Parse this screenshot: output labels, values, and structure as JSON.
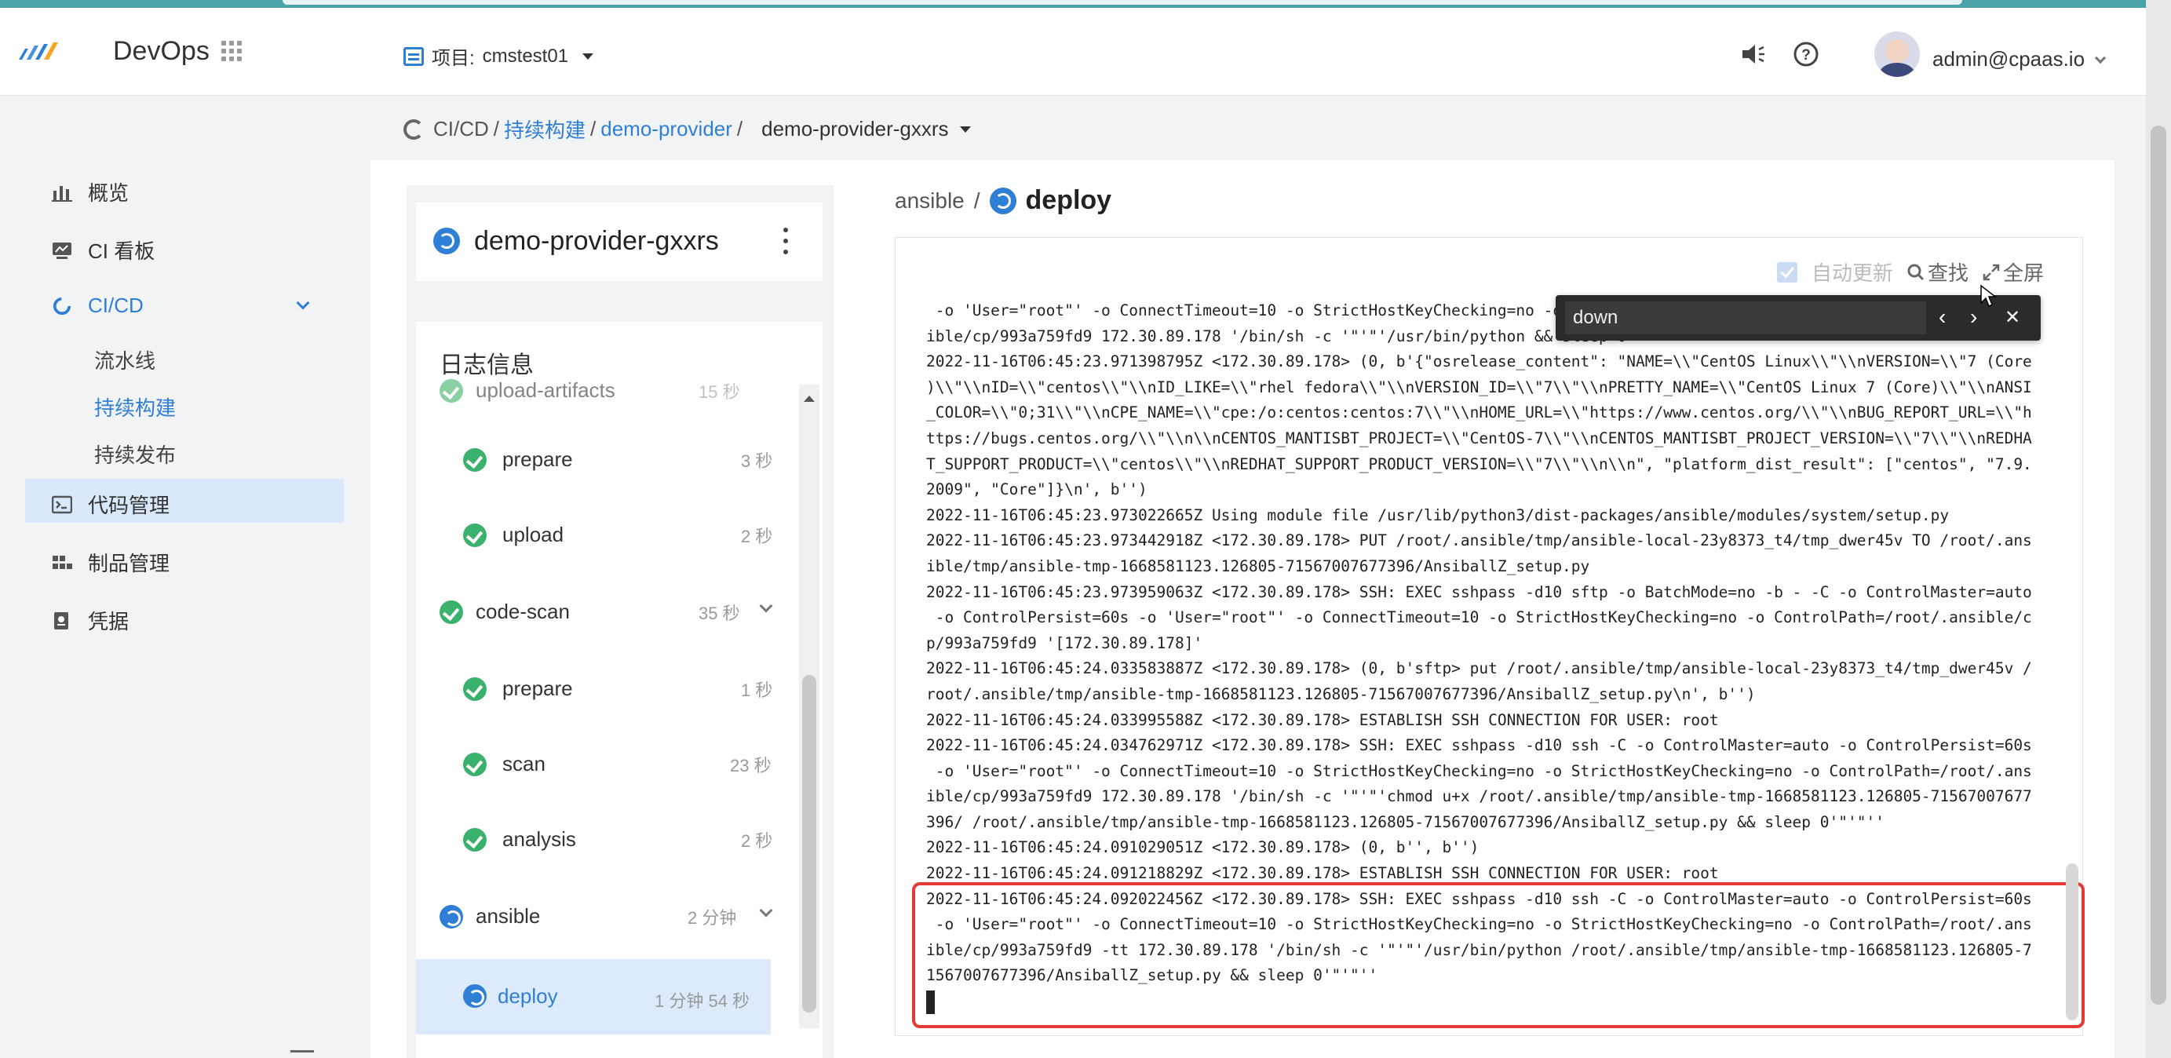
{
  "header": {
    "brand": "DevOps",
    "project_label": "项目:",
    "project_value": "cmstest01",
    "user": "admin@cpaas.io"
  },
  "breadcrumb": {
    "root": "CI/CD",
    "sep1": "/",
    "section": "持续构建",
    "sep2": "/",
    "pipeline": "demo-provider",
    "sep3": "/",
    "current": "demo-provider-gxxrs"
  },
  "sidebar": {
    "items": [
      {
        "label": "概览",
        "icon": "chart-icon"
      },
      {
        "label": "CI 看板",
        "icon": "dashboard-icon"
      },
      {
        "label": "CI/CD",
        "icon": "cicd-icon"
      },
      {
        "label": "流水线"
      },
      {
        "label": "持续构建"
      },
      {
        "label": "持续发布"
      },
      {
        "label": "代码管理",
        "icon": "code-icon"
      },
      {
        "label": "制品管理",
        "icon": "artifact-icon"
      },
      {
        "label": "凭据",
        "icon": "credential-icon"
      }
    ]
  },
  "build": {
    "title": "demo-provider-gxxrs",
    "log_header": "日志信息",
    "steps": [
      {
        "name": "upload-artifacts",
        "duration": "15 秒"
      },
      {
        "name": "prepare",
        "duration": "3 秒"
      },
      {
        "name": "upload",
        "duration": "2 秒"
      },
      {
        "name": "code-scan",
        "duration": "35 秒"
      },
      {
        "name": "prepare",
        "duration": "1 秒"
      },
      {
        "name": "scan",
        "duration": "23 秒"
      },
      {
        "name": "analysis",
        "duration": "2 秒"
      },
      {
        "name": "ansible",
        "duration": "2 分钟"
      },
      {
        "name": "deploy",
        "duration": "1 分钟 54 秒"
      }
    ]
  },
  "log_view": {
    "stage": "ansible",
    "sep": "/",
    "step": "deploy",
    "auto_update": "自动更新",
    "find": "查找",
    "fullscreen": "全屏",
    "search_value": "down",
    "lines": [
      " -o 'User=\"root\"' -o ConnectTimeout=10 -o StrictHostKeyChecking=no -o StrictHostKeyChecking=no -o ControlPath=/root/.ans",
      "ible/cp/993a759fd9 172.30.89.178 '/bin/sh -c '\"'\"'/usr/bin/python && sleep 0'\"'\"''",
      "2022-11-16T06:45:23.971398795Z <172.30.89.178> (0, b'{\"osrelease_content\": \"NAME=\\\\\"CentOS Linux\\\\\"\\\\nVERSION=\\\\\"7 (Core",
      ")\\\\\"\\\\nID=\\\\\"centos\\\\\"\\\\nID_LIKE=\\\\\"rhel fedora\\\\\"\\\\nVERSION_ID=\\\\\"7\\\\\"\\\\nPRETTY_NAME=\\\\\"CentOS Linux 7 (Core)\\\\\"\\\\nANSI",
      "_COLOR=\\\\\"0;31\\\\\"\\\\nCPE_NAME=\\\\\"cpe:/o:centos:centos:7\\\\\"\\\\nHOME_URL=\\\\\"https://www.centos.org/\\\\\"\\\\nBUG_REPORT_URL=\\\\\"h",
      "ttps://bugs.centos.org/\\\\\"\\\\n\\\\nCENTOS_MANTISBT_PROJECT=\\\\\"CentOS-7\\\\\"\\\\nCENTOS_MANTISBT_PROJECT_VERSION=\\\\\"7\\\\\"\\\\nREDHA",
      "T_SUPPORT_PRODUCT=\\\\\"centos\\\\\"\\\\nREDHAT_SUPPORT_PRODUCT_VERSION=\\\\\"7\\\\\"\\\\n\\\\n\", \"platform_dist_result\": [\"centos\", \"7.9.",
      "2009\", \"Core\"]}\\n', b'')",
      "2022-11-16T06:45:23.973022665Z Using module file /usr/lib/python3/dist-packages/ansible/modules/system/setup.py",
      "2022-11-16T06:45:23.973442918Z <172.30.89.178> PUT /root/.ansible/tmp/ansible-local-23y8373_t4/tmp_dwer45v TO /root/.ans",
      "ible/tmp/ansible-tmp-1668581123.126805-71567007677396/AnsiballZ_setup.py",
      "2022-11-16T06:45:23.973959063Z <172.30.89.178> SSH: EXEC sshpass -d10 sftp -o BatchMode=no -b - -C -o ControlMaster=auto",
      " -o ControlPersist=60s -o 'User=\"root\"' -o ConnectTimeout=10 -o StrictHostKeyChecking=no -o ControlPath=/root/.ansible/c",
      "p/993a759fd9 '[172.30.89.178]'",
      "2022-11-16T06:45:24.033583887Z <172.30.89.178> (0, b'sftp> put /root/.ansible/tmp/ansible-local-23y8373_t4/tmp_dwer45v /",
      "root/.ansible/tmp/ansible-tmp-1668581123.126805-71567007677396/AnsiballZ_setup.py\\n', b'')",
      "2022-11-16T06:45:24.033995588Z <172.30.89.178> ESTABLISH SSH CONNECTION FOR USER: root",
      "2022-11-16T06:45:24.034762971Z <172.30.89.178> SSH: EXEC sshpass -d10 ssh -C -o ControlMaster=auto -o ControlPersist=60s",
      " -o 'User=\"root\"' -o ConnectTimeout=10 -o StrictHostKeyChecking=no -o StrictHostKeyChecking=no -o ControlPath=/root/.ans",
      "ible/cp/993a759fd9 172.30.89.178 '/bin/sh -c '\"'\"'chmod u+x /root/.ansible/tmp/ansible-tmp-1668581123.126805-71567007677",
      "396/ /root/.ansible/tmp/ansible-tmp-1668581123.126805-71567007677396/AnsiballZ_setup.py && sleep 0'\"'\"''",
      "2022-11-16T06:45:24.091029051Z <172.30.89.178> (0, b'', b'')",
      "2022-11-16T06:45:24.091218829Z <172.30.89.178> ESTABLISH SSH CONNECTION FOR USER: root",
      "2022-11-16T06:45:24.092022456Z <172.30.89.178> SSH: EXEC sshpass -d10 ssh -C -o ControlMaster=auto -o ControlPersist=60s",
      " -o 'User=\"root\"' -o ConnectTimeout=10 -o StrictHostKeyChecking=no -o StrictHostKeyChecking=no -o ControlPath=/root/.ans",
      "ible/cp/993a759fd9 -tt 172.30.89.178 '/bin/sh -c '\"'\"'/usr/bin/python /root/.ansible/tmp/ansible-tmp-1668581123.126805-7",
      "1567007677396/AnsiballZ_setup.py && sleep 0'\"'\"''"
    ]
  },
  "colors": {
    "accent": "#2f7fd6",
    "success": "#3bb26b",
    "highlight_border": "#e53935",
    "active_nav_bg": "#d9e8fb"
  }
}
